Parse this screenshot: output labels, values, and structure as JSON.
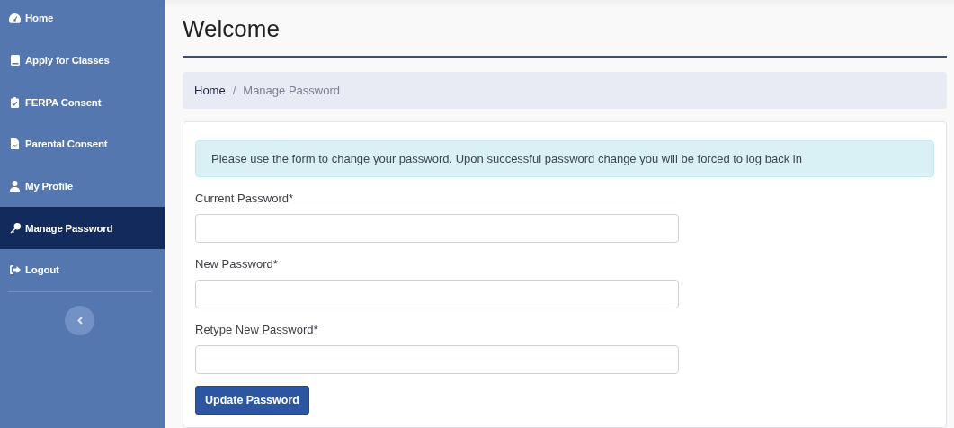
{
  "sidebar": {
    "items": [
      {
        "label": "Home",
        "selected": false
      },
      {
        "label": "Apply for Classes",
        "selected": false
      },
      {
        "label": "FERPA Consent",
        "selected": false
      },
      {
        "label": "Parental Consent",
        "selected": false
      },
      {
        "label": "My Profile",
        "selected": false
      },
      {
        "label": "Manage Password",
        "selected": true
      },
      {
        "label": "Logout",
        "selected": false
      }
    ]
  },
  "page": {
    "title": "Welcome"
  },
  "breadcrumb": {
    "separator": "/",
    "items": [
      {
        "label": "Home",
        "selected": false
      },
      {
        "label": "Manage Password",
        "selected": true
      }
    ]
  },
  "form": {
    "alert": "Please use the form to change your password. Upon successful password change you will be forced to log back in",
    "fields": [
      {
        "label": "Current Password*"
      },
      {
        "label": "New Password*"
      },
      {
        "label": "Retype New Password*"
      }
    ],
    "submit": "Update Password"
  }
}
